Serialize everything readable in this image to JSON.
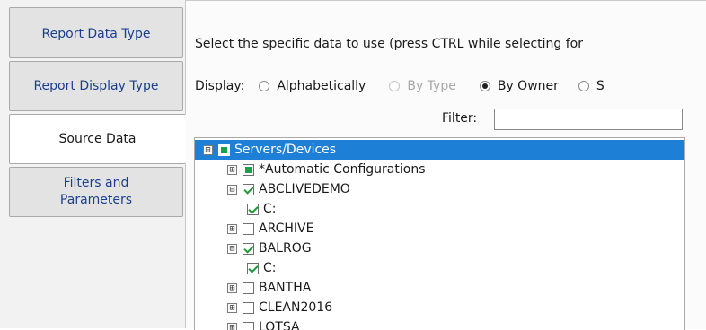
{
  "tabs": [
    {
      "label": "Report Data Type"
    },
    {
      "label": "Report Display Type"
    },
    {
      "label": "Source Data"
    },
    {
      "label": "Filters and Parameters"
    }
  ],
  "active_tab": "Source Data",
  "instruction": "Select the specific data to use (press CTRL while selecting for",
  "display": {
    "label": "Display:",
    "options": [
      {
        "label": "Alphabetically",
        "state": "unchecked"
      },
      {
        "label": "By Type",
        "state": "disabled"
      },
      {
        "label": "By Owner",
        "state": "checked"
      },
      {
        "label": "S",
        "state": "unchecked"
      }
    ]
  },
  "filter": {
    "label": "Filter:",
    "value": ""
  },
  "tree": [
    {
      "label": "Servers/Devices",
      "expander": "⊟",
      "check": "partial",
      "selected": true
    },
    {
      "label": "*Automatic Configurations",
      "expander": "⊞",
      "check": "partial"
    },
    {
      "label": "ABCLIVEDEMO",
      "expander": "⊟",
      "check": "checked"
    },
    {
      "label": "C:",
      "check": "checked"
    },
    {
      "label": "ARCHIVE",
      "expander": "⊞",
      "check": "unchecked"
    },
    {
      "label": "BALROG",
      "expander": "⊟",
      "check": "checked"
    },
    {
      "label": "C:",
      "check": "checked"
    },
    {
      "label": "BANTHA",
      "expander": "⊞",
      "check": "unchecked"
    },
    {
      "label": "CLEAN2016",
      "expander": "⊞",
      "check": "unchecked"
    },
    {
      "label": "LOTSA",
      "expander": "⊞",
      "check": "unchecked"
    }
  ],
  "colors": {
    "selection": "#1e7fd6",
    "tab_text": "#1b3f8e",
    "check_green": "#16a34a"
  }
}
